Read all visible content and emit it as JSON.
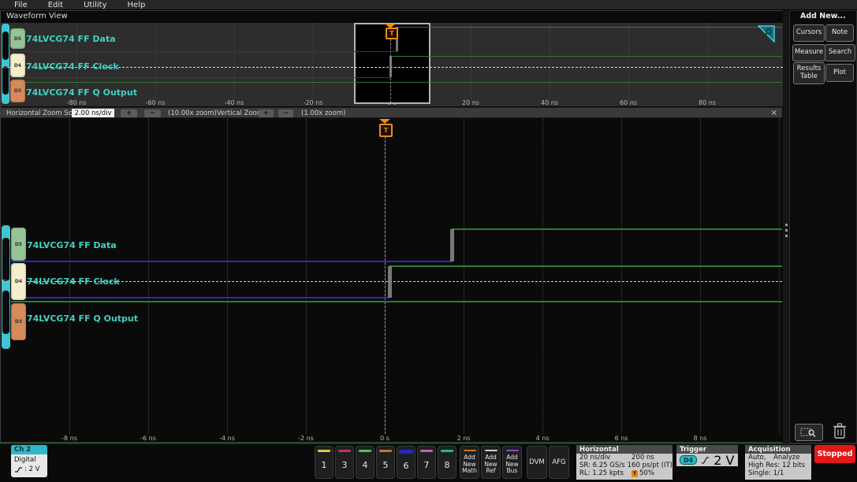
{
  "menu": {
    "items": [
      "File",
      "Edit",
      "Utility",
      "Help"
    ]
  },
  "waveform_view": {
    "title": "Waveform View",
    "trigger_marker": "T",
    "trigger_source_indicator": "<>",
    "channels": [
      {
        "id": "D5",
        "label": "74LVCG74 FF Data",
        "badge_color": "#97c497"
      },
      {
        "id": "D4",
        "label": "74LVCG74 FF Clock",
        "badge_color": "#f4eecb"
      },
      {
        "id": "D3",
        "label": "74LVCG74 FF Q Output",
        "badge_color": "#d58b5b"
      }
    ]
  },
  "overview": {
    "axis_ticks": [
      "-80 ns",
      "-60 ns",
      "-40 ns",
      "-20 ns",
      "0 s",
      "20 ns",
      "40 ns",
      "60 ns",
      "80 ns"
    ]
  },
  "main_view": {
    "axis_ticks": [
      "-8 ns",
      "-6 ns",
      "-4 ns",
      "-2 ns",
      "0 s",
      "2 ns",
      "4 ns",
      "6 ns",
      "8 ns"
    ]
  },
  "waveform_data": {
    "description": "Digital logic waveforms; green=high, blue=low, times in ns relative to trigger",
    "colors": {
      "low": "#2b2bb4",
      "high": "#2e7d2e",
      "edge": "#8b8b8b"
    },
    "channels": [
      {
        "name": "74LVCG74 FF Data",
        "segments": [
          {
            "level": "low",
            "t0": -1000,
            "t1": 1.7
          },
          {
            "level": "high",
            "t0": 1.7,
            "t1": 1000
          }
        ]
      },
      {
        "name": "74LVCG74 FF Clock",
        "segments": [
          {
            "level": "low",
            "t0": -1000,
            "t1": 0.12
          },
          {
            "level": "high",
            "t0": 0.12,
            "t1": 1000
          }
        ]
      },
      {
        "name": "74LVCG74 FF Q Output",
        "segments": [
          {
            "level": "high",
            "t0": -1000,
            "t1": 1000
          }
        ]
      }
    ]
  },
  "zoom_bar": {
    "h_label": "Horizontal Zoom Scale",
    "h_scale": "2.00 ns/div",
    "h_zoom": "(10.00x zoom)",
    "v_label": "Vertical Zoom",
    "v_zoom": "(1.00x zoom)",
    "plus": "+",
    "minus": "−",
    "close": "×"
  },
  "right_panel": {
    "title": "Add New...",
    "buttons": [
      "Cursors",
      "Note",
      "Measure",
      "Search",
      "Results Table",
      "Plot"
    ]
  },
  "bottom_bar": {
    "ch2": {
      "name": "Ch 2",
      "type": "Digital",
      "threshold": ": 2 V"
    },
    "channel_buttons": [
      {
        "label": "1",
        "color": "#d7c84b"
      },
      {
        "label": "3",
        "color": "#bc3558"
      },
      {
        "label": "4",
        "color": "#52c452"
      },
      {
        "label": "5",
        "color": "#cd7427"
      },
      {
        "label": "6",
        "color": "#2328c8",
        "thick": true
      },
      {
        "label": "7",
        "color": "#c55ec0"
      },
      {
        "label": "8",
        "color": "#23b795"
      }
    ],
    "add_buttons": [
      {
        "label": "Add New Math",
        "color": "#cd7427"
      },
      {
        "label": "Add New Ref",
        "color": "#cfcfcf"
      },
      {
        "label": "Add New Bus",
        "color": "#8c46d8"
      }
    ],
    "dvm": "DVM",
    "afg": "AFG",
    "horizontal": {
      "title": "Horizontal",
      "rows": [
        [
          "20 ns/div",
          "200 ns"
        ],
        [
          "SR: 6.25 GS/s",
          "160 ps/pt (IT)"
        ],
        [
          "RL: 1.25 kpts",
          "50%"
        ]
      ],
      "trigger_position_icon": "T"
    },
    "trigger": {
      "title": "Trigger",
      "source": "D4",
      "level": "2 V"
    },
    "acquisition": {
      "title": "Acquisition",
      "row1": [
        "Auto,",
        "Analyze"
      ],
      "rows": [
        "High Res: 12 bits",
        "Single: 1/1"
      ]
    },
    "stopped": "Stopped"
  }
}
